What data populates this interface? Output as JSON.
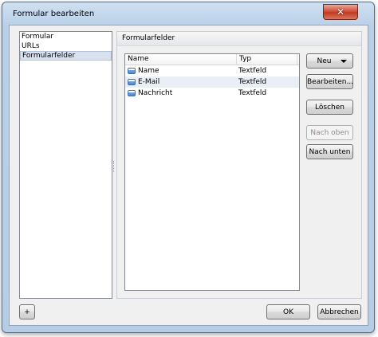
{
  "window": {
    "title": "Formular bearbeiten",
    "close_icon": "close-icon"
  },
  "sidebar": {
    "items": [
      {
        "label": "Formular",
        "selected": false
      },
      {
        "label": "URLs",
        "selected": false
      },
      {
        "label": "Formularfelder",
        "selected": true
      }
    ]
  },
  "panel": {
    "title": "Formularfelder",
    "columns": [
      "Name",
      "Typ"
    ],
    "rows": [
      {
        "name": "Name",
        "type": "Textfeld"
      },
      {
        "name": "E-Mail",
        "type": "Textfeld"
      },
      {
        "name": "Nachricht",
        "type": "Textfeld"
      }
    ]
  },
  "buttons": {
    "new": "Neu",
    "edit": "Bearbeiten...",
    "delete": "Löschen",
    "move_up": "Nach oben",
    "move_down": "Nach unten"
  },
  "footer": {
    "add": "+",
    "ok": "OK",
    "cancel": "Abbrechen"
  },
  "colors": {
    "frame": "#b9d0e8",
    "close": "#c23a22",
    "selection": "#d9e1ee"
  }
}
